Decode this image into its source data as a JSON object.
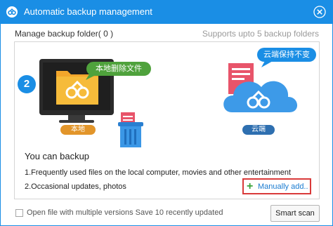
{
  "window": {
    "title": "Automatic backup management"
  },
  "header": {
    "manage_label": "Manage backup folder( 0 )",
    "supports_note": "Supports upto 5 backup folders"
  },
  "illustration": {
    "step_number": "2",
    "local_bubble": "本地删除文件",
    "cloud_bubble": "云端保持不变",
    "local_tag": "本地",
    "cloud_tag": "云端"
  },
  "info": {
    "heading": "You can backup",
    "line1": "1.Frequently used files on the local computer, movies and other entertainment",
    "line2": "2.Occasional updates, photos"
  },
  "actions": {
    "manual_add_label": "Manually add..",
    "smart_scan_label": "Smart scan"
  },
  "footer": {
    "checkbox_checked": false,
    "checkbox_label": "Open file with multiple versions Save 10 recently updated"
  },
  "colors": {
    "title_bar": "#1a8ee5",
    "local_tag": "#e2952a",
    "cloud_tag": "#2e6fb0",
    "local_bubble": "#4fa23c",
    "manual_add_border": "#d93a3a",
    "manual_add_plus": "#3aa33a"
  },
  "icons": [
    "app-logo-icon",
    "close-icon",
    "monitor-icon",
    "folder-icon",
    "document-icon",
    "trash-icon",
    "cloud-icon",
    "plus-icon"
  ]
}
